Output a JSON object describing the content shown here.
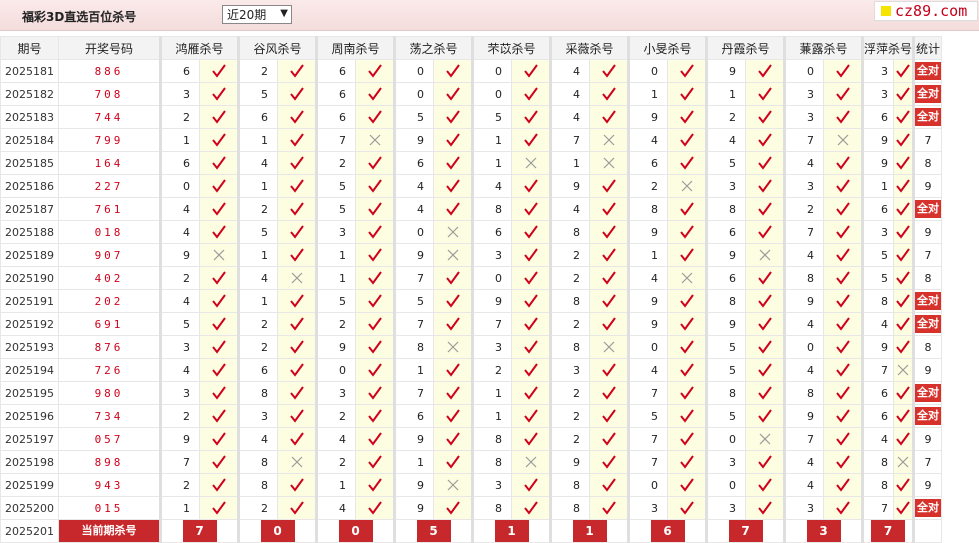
{
  "header": {
    "title": "福彩3D直选百位杀号",
    "period_selected": "近20期",
    "brand": "cz89.com"
  },
  "columns": {
    "issue": "期号",
    "draw": "开奖号码",
    "experts": [
      "鸿雁杀号",
      "谷风杀号",
      "周南杀号",
      "荡之杀号",
      "芣苡杀号",
      "采薇杀号",
      "小旻杀号",
      "丹霞杀号",
      "蒹露杀号",
      "浮萍杀号"
    ],
    "stat": "统计"
  },
  "status_colors": {
    "hit": "#d0021b",
    "miss": "#9a9a9a",
    "badge": "#d6312b"
  },
  "rows": [
    {
      "issue": "2025181",
      "draw": "886",
      "kills": [
        "6",
        "2",
        "6",
        "0",
        "0",
        "4",
        "0",
        "9",
        "0",
        "3"
      ],
      "ok": [
        1,
        1,
        1,
        1,
        1,
        1,
        1,
        1,
        1,
        1
      ],
      "stat": "全对"
    },
    {
      "issue": "2025182",
      "draw": "708",
      "kills": [
        "3",
        "5",
        "6",
        "0",
        "0",
        "4",
        "1",
        "1",
        "3",
        "3"
      ],
      "ok": [
        1,
        1,
        1,
        1,
        1,
        1,
        1,
        1,
        1,
        1
      ],
      "stat": "全对"
    },
    {
      "issue": "2025183",
      "draw": "744",
      "kills": [
        "2",
        "6",
        "6",
        "5",
        "5",
        "4",
        "9",
        "2",
        "3",
        "6"
      ],
      "ok": [
        1,
        1,
        1,
        1,
        1,
        1,
        1,
        1,
        1,
        1
      ],
      "stat": "全对"
    },
    {
      "issue": "2025184",
      "draw": "799",
      "kills": [
        "1",
        "1",
        "7",
        "9",
        "1",
        "7",
        "4",
        "4",
        "7",
        "9"
      ],
      "ok": [
        1,
        1,
        0,
        1,
        1,
        0,
        1,
        1,
        0,
        1
      ],
      "stat": "7"
    },
    {
      "issue": "2025185",
      "draw": "164",
      "kills": [
        "6",
        "4",
        "2",
        "6",
        "1",
        "1",
        "6",
        "5",
        "4",
        "9"
      ],
      "ok": [
        1,
        1,
        1,
        1,
        0,
        0,
        1,
        1,
        1,
        1
      ],
      "stat": "8"
    },
    {
      "issue": "2025186",
      "draw": "227",
      "kills": [
        "0",
        "1",
        "5",
        "4",
        "4",
        "9",
        "2",
        "3",
        "3",
        "1"
      ],
      "ok": [
        1,
        1,
        1,
        1,
        1,
        1,
        0,
        1,
        1,
        1
      ],
      "stat": "9"
    },
    {
      "issue": "2025187",
      "draw": "761",
      "kills": [
        "4",
        "2",
        "5",
        "4",
        "8",
        "4",
        "8",
        "8",
        "2",
        "6"
      ],
      "ok": [
        1,
        1,
        1,
        1,
        1,
        1,
        1,
        1,
        1,
        1
      ],
      "stat": "全对"
    },
    {
      "issue": "2025188",
      "draw": "018",
      "kills": [
        "4",
        "5",
        "3",
        "0",
        "6",
        "8",
        "9",
        "6",
        "7",
        "3"
      ],
      "ok": [
        1,
        1,
        1,
        0,
        1,
        1,
        1,
        1,
        1,
        1
      ],
      "stat": "9"
    },
    {
      "issue": "2025189",
      "draw": "907",
      "kills": [
        "9",
        "1",
        "1",
        "9",
        "3",
        "2",
        "1",
        "9",
        "4",
        "5"
      ],
      "ok": [
        0,
        1,
        1,
        0,
        1,
        1,
        1,
        0,
        1,
        1
      ],
      "stat": "7"
    },
    {
      "issue": "2025190",
      "draw": "402",
      "kills": [
        "2",
        "4",
        "1",
        "7",
        "0",
        "2",
        "4",
        "6",
        "8",
        "5"
      ],
      "ok": [
        1,
        0,
        1,
        1,
        1,
        1,
        0,
        1,
        1,
        1
      ],
      "stat": "8"
    },
    {
      "issue": "2025191",
      "draw": "202",
      "kills": [
        "4",
        "1",
        "5",
        "5",
        "9",
        "8",
        "9",
        "8",
        "9",
        "8"
      ],
      "ok": [
        1,
        1,
        1,
        1,
        1,
        1,
        1,
        1,
        1,
        1
      ],
      "stat": "全对"
    },
    {
      "issue": "2025192",
      "draw": "691",
      "kills": [
        "5",
        "2",
        "2",
        "7",
        "7",
        "2",
        "9",
        "9",
        "4",
        "4"
      ],
      "ok": [
        1,
        1,
        1,
        1,
        1,
        1,
        1,
        1,
        1,
        1
      ],
      "stat": "全对"
    },
    {
      "issue": "2025193",
      "draw": "876",
      "kills": [
        "3",
        "2",
        "9",
        "8",
        "3",
        "8",
        "0",
        "5",
        "0",
        "9"
      ],
      "ok": [
        1,
        1,
        1,
        0,
        1,
        0,
        1,
        1,
        1,
        1
      ],
      "stat": "8"
    },
    {
      "issue": "2025194",
      "draw": "726",
      "kills": [
        "4",
        "6",
        "0",
        "1",
        "2",
        "3",
        "4",
        "5",
        "4",
        "7"
      ],
      "ok": [
        1,
        1,
        1,
        1,
        1,
        1,
        1,
        1,
        1,
        0
      ],
      "stat": "9"
    },
    {
      "issue": "2025195",
      "draw": "980",
      "kills": [
        "3",
        "8",
        "3",
        "7",
        "1",
        "2",
        "7",
        "8",
        "8",
        "6"
      ],
      "ok": [
        1,
        1,
        1,
        1,
        1,
        1,
        1,
        1,
        1,
        1
      ],
      "stat": "全对"
    },
    {
      "issue": "2025196",
      "draw": "734",
      "kills": [
        "2",
        "3",
        "2",
        "6",
        "1",
        "2",
        "5",
        "5",
        "9",
        "6"
      ],
      "ok": [
        1,
        1,
        1,
        1,
        1,
        1,
        1,
        1,
        1,
        1
      ],
      "stat": "全对"
    },
    {
      "issue": "2025197",
      "draw": "057",
      "kills": [
        "9",
        "4",
        "4",
        "9",
        "8",
        "2",
        "7",
        "0",
        "7",
        "4"
      ],
      "ok": [
        1,
        1,
        1,
        1,
        1,
        1,
        1,
        0,
        1,
        1
      ],
      "stat": "9"
    },
    {
      "issue": "2025198",
      "draw": "898",
      "kills": [
        "7",
        "8",
        "2",
        "1",
        "8",
        "9",
        "7",
        "3",
        "4",
        "8"
      ],
      "ok": [
        1,
        0,
        1,
        1,
        0,
        1,
        1,
        1,
        1,
        0
      ],
      "stat": "7"
    },
    {
      "issue": "2025199",
      "draw": "943",
      "kills": [
        "2",
        "8",
        "1",
        "9",
        "3",
        "8",
        "0",
        "0",
        "4",
        "8"
      ],
      "ok": [
        1,
        1,
        1,
        0,
        1,
        1,
        1,
        1,
        1,
        1
      ],
      "stat": "9"
    },
    {
      "issue": "2025200",
      "draw": "015",
      "kills": [
        "1",
        "2",
        "4",
        "9",
        "8",
        "8",
        "3",
        "3",
        "3",
        "7"
      ],
      "ok": [
        1,
        1,
        1,
        1,
        1,
        1,
        1,
        1,
        1,
        1
      ],
      "stat": "全对"
    }
  ],
  "current": {
    "issue": "2025201",
    "label": "当前期杀号",
    "kills": [
      "7",
      "0",
      "0",
      "5",
      "1",
      "1",
      "6",
      "7",
      "3",
      "7"
    ]
  }
}
